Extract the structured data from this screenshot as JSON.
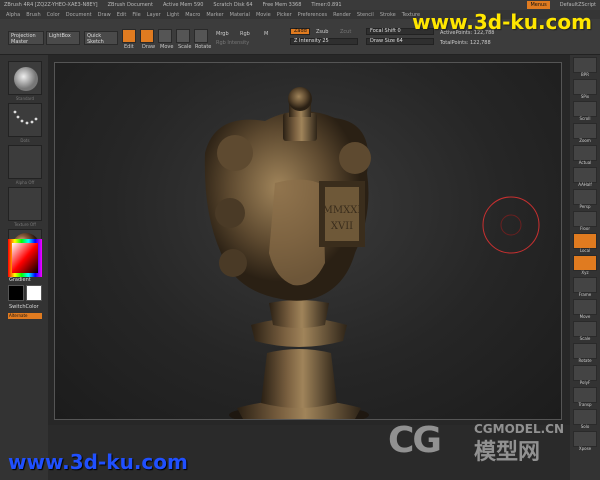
{
  "titlebar": {
    "app": "ZBrush 4R4 [ZQ2Z-YHEO-XAE3-N8EY]",
    "document": "ZBrush Document",
    "active_mem": "Active Mem 590",
    "scratch": "Scratch Disk 64",
    "free_mem": "Free Mem 3368",
    "timer": "Timer:0.891",
    "menus_button": "Menus",
    "script": "DefaultZScript"
  },
  "menubar": [
    "Alpha",
    "Brush",
    "Color",
    "Document",
    "Draw",
    "Edit",
    "File",
    "Layer",
    "Light",
    "Macro",
    "Marker",
    "Material",
    "Movie",
    "Picker",
    "Preferences",
    "Render",
    "Stencil",
    "Stroke",
    "Texture"
  ],
  "toolbar": {
    "projection_master": "Projection Master",
    "lightbox": "LightBox",
    "quick_sketch": "Quick Sketch",
    "edit": "Edit",
    "draw": "Draw",
    "move": "Move",
    "scale": "Scale",
    "rotate": "Rotate",
    "mrgb": "Mrgb",
    "rgb": "Rgb",
    "m": "M",
    "rgb_intensity": "Rgb Intensity",
    "zadd": "Zadd",
    "zsub": "Zsub",
    "zcut": "Zcut",
    "z_intensity": "Z Intensity 25",
    "focal_shift": "Focal Shift 0",
    "draw_size": "Draw Size 64",
    "active_points": "ActivePoints: 122,788",
    "total_points": "TotalPoints: 122,788"
  },
  "left_panel": {
    "standard": "Standard",
    "dots": "Dots",
    "alpha_off": "Alpha Off",
    "texture_off": "Texture Off",
    "gradient": "Gradient",
    "switch_color": "SwitchColor",
    "alternate": "Alternate"
  },
  "right_panel": [
    "BPR",
    "SPix",
    "Scroll",
    "Zoom",
    "Actual",
    "AAHalf",
    "Persp",
    "Floor",
    "Local",
    "Xyz",
    "Frame",
    "Move",
    "Scale",
    "Rotate",
    "PolyF",
    "Transp",
    "Solo",
    "Xpose"
  ],
  "watermarks": {
    "top": "www.3d-ku.com",
    "bottom": "www.3d-ku.com",
    "cg": "CG",
    "cg_site": "CGMODEL.CN",
    "cg_cn": "模型网"
  },
  "colors": {
    "accent": "#e07b20",
    "watermark_top": "#ffe600",
    "watermark_bottom": "#2050ff",
    "bronze": "#6b5434"
  }
}
